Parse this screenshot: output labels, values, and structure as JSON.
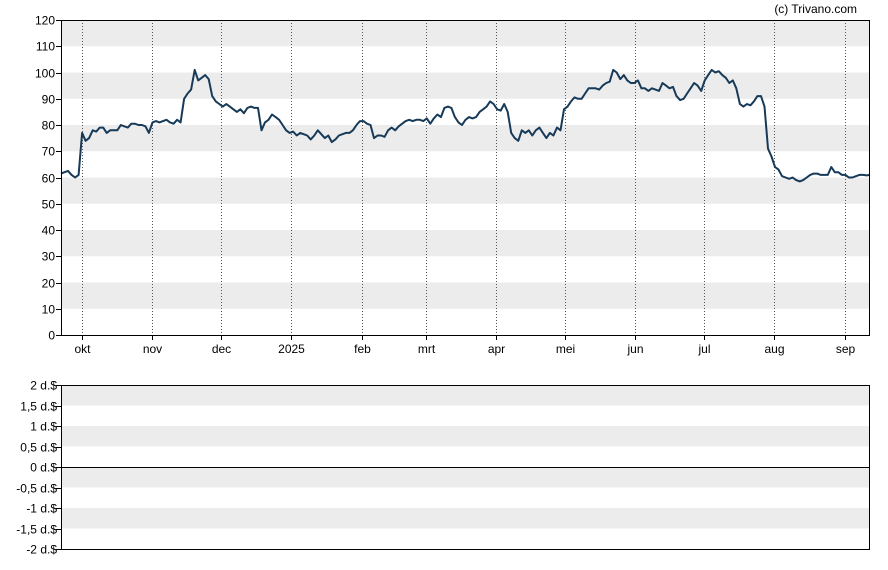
{
  "copyright": "(c) Trivano.com",
  "chart_data": [
    {
      "type": "line",
      "title": "",
      "xlabel": "",
      "ylabel": "",
      "ylim": [
        0,
        120
      ],
      "yticks": [
        "0",
        "10",
        "20",
        "30",
        "40",
        "50",
        "60",
        "70",
        "80",
        "90",
        "100",
        "110",
        "120"
      ],
      "x_tick_labels": [
        {
          "label": "okt",
          "day": 9
        },
        {
          "label": "nov",
          "day": 40
        },
        {
          "label": "dec",
          "day": 70
        },
        {
          "label": "2025",
          "day": 101
        },
        {
          "label": "feb",
          "day": 132
        },
        {
          "label": "mrt",
          "day": 160
        },
        {
          "label": "apr",
          "day": 191
        },
        {
          "label": "mei",
          "day": 221
        },
        {
          "label": "jun",
          "day": 252
        },
        {
          "label": "jul",
          "day": 282
        },
        {
          "label": "aug",
          "day": 313
        },
        {
          "label": "sep",
          "day": 344
        }
      ],
      "x_range_days": [
        0,
        355
      ],
      "grid": true,
      "series": [
        {
          "color": "#163a58",
          "points": [
            [
              0,
              61.5
            ],
            [
              1,
              62
            ],
            [
              2,
              62.5
            ],
            [
              3,
              61
            ],
            [
              4,
              60
            ],
            [
              5,
              61
            ],
            [
              6,
              77
            ],
            [
              7,
              74
            ],
            [
              8,
              75
            ],
            [
              9,
              78
            ],
            [
              10,
              77.5
            ],
            [
              11,
              79
            ],
            [
              12,
              79
            ],
            [
              13,
              77
            ],
            [
              14,
              78
            ],
            [
              15,
              78
            ],
            [
              16,
              78
            ],
            [
              17,
              80
            ],
            [
              18,
              79.5
            ],
            [
              19,
              79
            ],
            [
              20,
              80.5
            ],
            [
              21,
              80.5
            ],
            [
              22,
              80
            ],
            [
              23,
              80
            ],
            [
              24,
              79.5
            ],
            [
              25,
              77
            ],
            [
              26,
              81
            ],
            [
              27,
              81.5
            ],
            [
              28,
              81
            ],
            [
              29,
              81.5
            ],
            [
              30,
              82
            ],
            [
              31,
              81
            ],
            [
              32,
              80.5
            ],
            [
              33,
              82
            ],
            [
              34,
              81
            ],
            [
              35,
              90
            ],
            [
              36,
              92
            ],
            [
              37,
              93.5
            ],
            [
              38,
              101
            ],
            [
              39,
              97
            ],
            [
              40,
              98
            ],
            [
              41,
              99
            ],
            [
              42,
              97.5
            ],
            [
              43,
              91
            ],
            [
              44,
              89
            ],
            [
              45,
              88
            ],
            [
              46,
              87
            ],
            [
              47,
              88
            ],
            [
              48,
              87
            ],
            [
              49,
              86
            ],
            [
              50,
              85
            ],
            [
              51,
              86
            ],
            [
              52,
              84.5
            ],
            [
              53,
              86.5
            ],
            [
              54,
              87
            ],
            [
              55,
              86.5
            ],
            [
              56,
              86.5
            ],
            [
              57,
              78
            ],
            [
              58,
              81
            ],
            [
              59,
              82
            ],
            [
              60,
              84
            ],
            [
              61,
              83
            ],
            [
              62,
              82
            ],
            [
              63,
              80
            ],
            [
              64,
              78
            ],
            [
              65,
              77
            ],
            [
              66,
              77.5
            ],
            [
              67,
              76
            ],
            [
              68,
              77
            ],
            [
              69,
              76.5
            ],
            [
              70,
              76
            ],
            [
              71,
              74.5
            ],
            [
              72,
              76
            ],
            [
              73,
              78
            ],
            [
              74,
              76.5
            ],
            [
              75,
              75
            ],
            [
              76,
              76
            ],
            [
              77,
              73.5
            ],
            [
              78,
              74.5
            ],
            [
              79,
              76
            ],
            [
              80,
              76.5
            ],
            [
              81,
              77
            ],
            [
              82,
              77
            ],
            [
              83,
              78
            ],
            [
              84,
              80
            ],
            [
              85,
              81.5
            ],
            [
              86,
              81.5
            ],
            [
              87,
              80.5
            ],
            [
              88,
              80
            ],
            [
              89,
              75
            ],
            [
              90,
              76
            ],
            [
              91,
              76
            ],
            [
              92,
              75.5
            ],
            [
              93,
              78
            ],
            [
              94,
              79
            ],
            [
              95,
              78
            ],
            [
              96,
              79.5
            ],
            [
              97,
              80.5
            ],
            [
              98,
              81.5
            ],
            [
              99,
              82
            ],
            [
              100,
              81.5
            ],
            [
              101,
              82
            ],
            [
              102,
              82
            ],
            [
              103,
              81.5
            ],
            [
              104,
              82.5
            ],
            [
              105,
              80.5
            ],
            [
              106,
              82.5
            ],
            [
              107,
              84
            ],
            [
              108,
              83
            ],
            [
              109,
              86.5
            ],
            [
              110,
              87
            ],
            [
              111,
              86.5
            ],
            [
              112,
              83
            ],
            [
              113,
              81
            ],
            [
              114,
              80
            ],
            [
              115,
              82
            ],
            [
              116,
              83
            ],
            [
              117,
              82.5
            ],
            [
              118,
              83
            ],
            [
              119,
              85
            ],
            [
              120,
              86
            ],
            [
              121,
              87
            ],
            [
              122,
              89
            ],
            [
              123,
              88
            ],
            [
              124,
              86
            ],
            [
              125,
              85.5
            ],
            [
              126,
              88
            ],
            [
              127,
              85
            ],
            [
              128,
              77
            ],
            [
              129,
              75
            ],
            [
              130,
              74
            ],
            [
              131,
              78
            ],
            [
              132,
              77
            ],
            [
              133,
              78
            ],
            [
              134,
              76
            ],
            [
              135,
              78
            ],
            [
              136,
              79
            ],
            [
              137,
              77
            ],
            [
              138,
              75
            ],
            [
              139,
              77
            ],
            [
              140,
              76
            ],
            [
              141,
              79
            ],
            [
              142,
              78
            ],
            [
              143,
              86
            ],
            [
              144,
              87
            ],
            [
              145,
              89
            ],
            [
              146,
              90.5
            ],
            [
              147,
              90
            ],
            [
              148,
              90
            ],
            [
              149,
              92
            ],
            [
              150,
              94
            ],
            [
              151,
              94
            ],
            [
              152,
              94
            ],
            [
              153,
              93.5
            ],
            [
              154,
              95
            ],
            [
              155,
              96
            ],
            [
              156,
              96.5
            ],
            [
              157,
              101
            ],
            [
              158,
              100
            ],
            [
              159,
              97.5
            ],
            [
              160,
              99
            ],
            [
              161,
              97
            ],
            [
              162,
              96
            ],
            [
              163,
              96
            ],
            [
              164,
              97
            ],
            [
              165,
              94
            ],
            [
              166,
              94
            ],
            [
              167,
              93
            ],
            [
              168,
              94
            ],
            [
              169,
              93.5
            ],
            [
              170,
              93
            ],
            [
              171,
              96
            ],
            [
              172,
              95
            ],
            [
              173,
              94
            ],
            [
              174,
              94.5
            ],
            [
              175,
              91
            ],
            [
              176,
              89.5
            ],
            [
              177,
              90
            ],
            [
              178,
              92
            ],
            [
              179,
              94
            ],
            [
              180,
              96
            ],
            [
              181,
              95
            ],
            [
              182,
              93
            ],
            [
              183,
              97
            ],
            [
              184,
              99
            ],
            [
              185,
              101
            ],
            [
              186,
              100
            ],
            [
              187,
              100.5
            ],
            [
              188,
              99
            ],
            [
              189,
              98
            ],
            [
              190,
              96
            ],
            [
              191,
              97
            ],
            [
              192,
              94
            ],
            [
              193,
              88
            ],
            [
              194,
              87
            ],
            [
              195,
              88
            ],
            [
              196,
              87.5
            ],
            [
              197,
              89
            ],
            [
              198,
              91
            ],
            [
              199,
              91
            ],
            [
              200,
              87
            ],
            [
              201,
              71
            ],
            [
              202,
              68
            ],
            [
              203,
              64
            ],
            [
              204,
              63
            ],
            [
              205,
              60.5
            ],
            [
              206,
              60
            ],
            [
              207,
              59.5
            ],
            [
              208,
              60
            ],
            [
              209,
              59
            ],
            [
              210,
              58.5
            ],
            [
              211,
              59
            ],
            [
              212,
              60
            ],
            [
              213,
              61
            ],
            [
              214,
              61.5
            ],
            [
              215,
              61.5
            ],
            [
              216,
              61
            ],
            [
              217,
              61
            ],
            [
              218,
              61
            ],
            [
              219,
              64
            ],
            [
              220,
              62
            ],
            [
              221,
              62
            ],
            [
              222,
              61
            ],
            [
              223,
              61
            ],
            [
              224,
              60
            ],
            [
              225,
              60
            ],
            [
              226,
              60.5
            ],
            [
              227,
              61
            ],
            [
              228,
              61
            ],
            [
              229,
              60.8
            ],
            [
              230,
              61
            ]
          ]
        }
      ]
    },
    {
      "type": "line",
      "title": "",
      "xlabel": "",
      "ylabel": "",
      "ylim": [
        -2,
        2
      ],
      "yticks": [
        "-2 d.$",
        "-1,5 d.$",
        "-1 d.$",
        "-0,5 d.$",
        "0 d.$",
        "0,5 d.$",
        "1 d.$",
        "1,5 d.$",
        "2 d.$"
      ],
      "ytick_values": [
        -2,
        -1.5,
        -1,
        -0.5,
        0,
        0.5,
        1,
        1.5,
        2
      ],
      "grid": true,
      "baseline": 0,
      "series": []
    }
  ]
}
